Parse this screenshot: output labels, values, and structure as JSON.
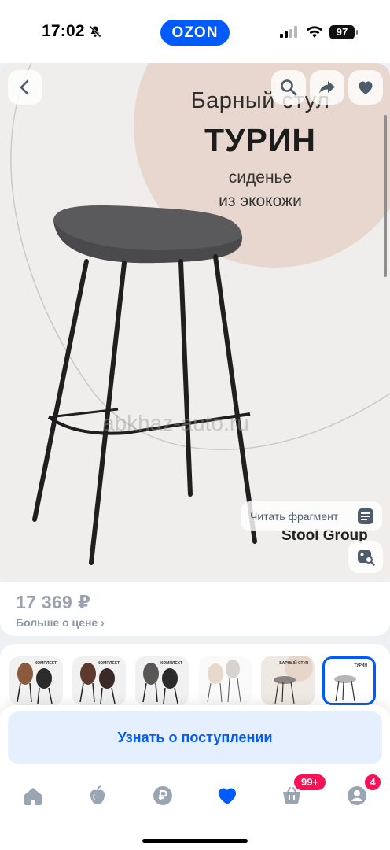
{
  "status_bar": {
    "time": "17:02",
    "app_brand": "OZON",
    "battery": "97",
    "icons": [
      "bell-mute-icon",
      "cellular-signal-icon",
      "wifi-icon",
      "battery-icon"
    ]
  },
  "gallery": {
    "promo_line1": "Барный стул",
    "promo_title": "ТУРИН",
    "promo_line3": "сиденье",
    "promo_line4": "из экокожи",
    "watermark": "abkhaz-auto.ru",
    "maker": "Stool Group",
    "read_fragment": "Читать фрагмент",
    "icons": [
      "back-arrow-icon",
      "search-icon",
      "share-icon",
      "heart-icon",
      "reader-icon",
      "image-search-icon"
    ]
  },
  "price_block": {
    "price": "17 369 ₽",
    "more_price": "Больше о цене ›"
  },
  "variants": [
    {
      "name": "variant-brown-black",
      "caption": "КОМПЛЕКТ",
      "selected": false
    },
    {
      "name": "variant-brown-dark",
      "caption": "КОМПЛЕКТ",
      "selected": false
    },
    {
      "name": "variant-grey-black",
      "caption": "КОМПЛЕКТ",
      "selected": false
    },
    {
      "name": "variant-beige",
      "caption": "",
      "selected": false
    },
    {
      "name": "variant-beige-promo",
      "caption": "БАРНЫЙ СТУЛ",
      "selected": false
    },
    {
      "name": "variant-grey-promo",
      "caption": "ТУРИН",
      "selected": true
    }
  ],
  "notify_button": "Узнать о поступлении",
  "bottom_nav": {
    "items": [
      "home-icon",
      "fresh-icon",
      "ruble-icon",
      "favorites-heart-icon",
      "cart-icon",
      "profile-icon"
    ],
    "cart_badge": "99+",
    "profile_badge": "4",
    "active_color": "#005bff",
    "inactive_color": "#9aa5b3"
  },
  "colors": {
    "brand_blue": "#005bff",
    "badge_pink": "#f91155"
  }
}
